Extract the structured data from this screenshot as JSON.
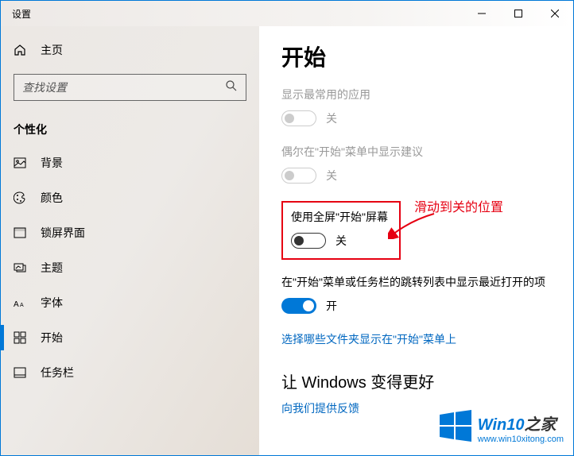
{
  "titlebar": {
    "title": "设置"
  },
  "sidebar": {
    "home": "主页",
    "search_placeholder": "查找设置",
    "section": "个性化",
    "items": [
      {
        "label": "背景"
      },
      {
        "label": "颜色"
      },
      {
        "label": "锁屏界面"
      },
      {
        "label": "主题"
      },
      {
        "label": "字体"
      },
      {
        "label": "开始"
      },
      {
        "label": "任务栏"
      }
    ]
  },
  "main": {
    "heading": "开始",
    "settings": [
      {
        "label": "显示最常用的应用",
        "state": "关",
        "disabled": true
      },
      {
        "label": "偶尔在\"开始\"菜单中显示建议",
        "state": "关",
        "disabled": true
      },
      {
        "label": "使用全屏\"开始\"屏幕",
        "state": "关",
        "disabled": false,
        "highlighted": true
      },
      {
        "label": "在\"开始\"菜单或任务栏的跳转列表中显示最近打开的项",
        "state": "开",
        "disabled": false
      }
    ],
    "link1": "选择哪些文件夹显示在\"开始\"菜单上",
    "section2": "让 Windows 变得更好",
    "link2": "向我们提供反馈"
  },
  "annotation": "滑动到关的位置",
  "watermark": {
    "title_a": "Win10",
    "title_b": "之家",
    "url": "www.win10xitong.com"
  }
}
